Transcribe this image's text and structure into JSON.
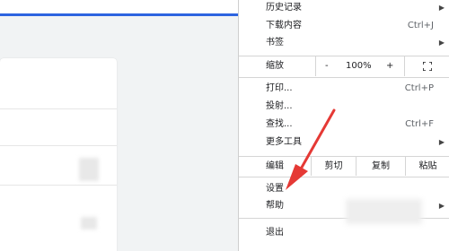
{
  "menu": {
    "history": "历史记录",
    "downloads": {
      "label": "下载内容",
      "shortcut": "Ctrl+J"
    },
    "bookmarks": "书签",
    "zoom": {
      "label": "缩放",
      "minus": "-",
      "value": "100%",
      "plus": "+"
    },
    "print": {
      "label": "打印...",
      "shortcut": "Ctrl+P"
    },
    "cast": "投射...",
    "find": {
      "label": "查找...",
      "shortcut": "Ctrl+F"
    },
    "more_tools": "更多工具",
    "edit": {
      "label": "编辑",
      "cut": "剪切",
      "copy": "复制",
      "paste": "粘贴"
    },
    "settings": "设置",
    "help": "帮助",
    "exit": "退出"
  },
  "icons": {
    "submenu": "chevron-right-icon",
    "fullscreen": "fullscreen-icon"
  },
  "colors": {
    "arrow": "#e53935",
    "accent": "#2d64e0"
  }
}
